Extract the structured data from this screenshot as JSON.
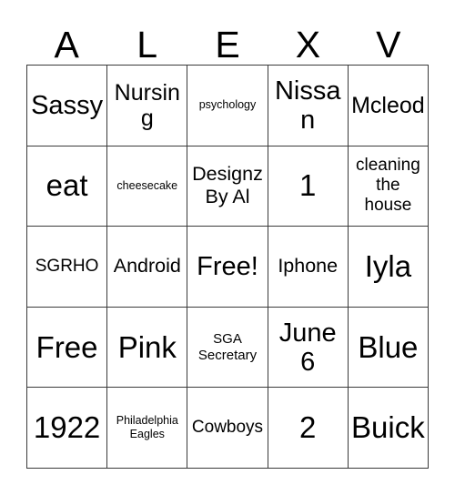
{
  "card": {
    "title_letters": [
      "A",
      "L",
      "E",
      "X",
      "V"
    ],
    "columns": 5,
    "rows": 5,
    "border_color": "#3a3a3a",
    "background_color": "#ffffff",
    "text_color": "#000000",
    "free_space": "Free!",
    "cells": [
      [
        {
          "text": "Sassy",
          "size": "fs-xxl"
        },
        {
          "text": "Nursing",
          "size": "fs-xl"
        },
        {
          "text": "psychology",
          "size": "fs-xs"
        },
        {
          "text": "Nissan",
          "size": "fs-xxl"
        },
        {
          "text": "Mcleod",
          "size": "fs-xl"
        }
      ],
      [
        {
          "text": "eat",
          "size": "fs-huge"
        },
        {
          "text": "cheesecake",
          "size": "fs-xs"
        },
        {
          "text": "Designz\nBy Al",
          "size": "fs-lg"
        },
        {
          "text": "1",
          "size": "fs-huge"
        },
        {
          "text": "cleaning\nthe\nhouse",
          "size": "fs-md"
        }
      ],
      [
        {
          "text": "SGRHO",
          "size": "fs-md"
        },
        {
          "text": "Android",
          "size": "fs-lg"
        },
        {
          "text": "Free!",
          "size": "fs-xxl"
        },
        {
          "text": "Iphone",
          "size": "fs-lg"
        },
        {
          "text": "Iyla",
          "size": "fs-huge"
        }
      ],
      [
        {
          "text": "Free",
          "size": "fs-huge"
        },
        {
          "text": "Pink",
          "size": "fs-huge"
        },
        {
          "text": "SGA\nSecretary",
          "size": "fs-sm"
        },
        {
          "text": "June\n6",
          "size": "fs-xxl"
        },
        {
          "text": "Blue",
          "size": "fs-huge"
        }
      ],
      [
        {
          "text": "1922",
          "size": "fs-huge"
        },
        {
          "text": "Philadelphia\nEagles",
          "size": "fs-xs"
        },
        {
          "text": "Cowboys",
          "size": "fs-md"
        },
        {
          "text": "2",
          "size": "fs-huge"
        },
        {
          "text": "Buick",
          "size": "fs-huge"
        }
      ]
    ]
  }
}
